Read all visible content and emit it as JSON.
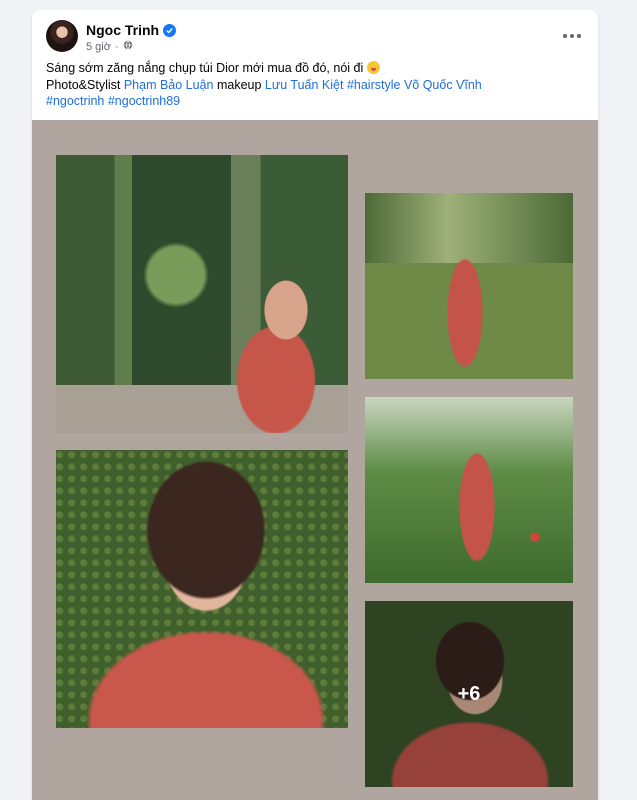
{
  "post": {
    "author": "Ngoc Trinh",
    "time": "5 giờ",
    "caption": {
      "line1": "Sáng sớm zăng nắng chụp túi Dior mới mua đồ đó, nói đi",
      "photo_prefix": "Photo&Stylist ",
      "photo_credit": "Phạm Bảo Luận",
      "makeup_prefix": "  makeup ",
      "makeup_credit": "Lưu Tuấn Kiệt",
      "hashtag_hairstyle": "#hairstyle",
      "hairstyle_credit": "Võ Quốc Vĩnh",
      "hashtag1": "#ngoctrinh",
      "hashtag2": "#ngoctrinh89"
    },
    "more_photos_label": "+6"
  },
  "icons": {
    "verified": "verified-badge-icon",
    "privacy": "globe-icon",
    "more": "more-options-icon",
    "emoji": "tongue-out-emoji"
  },
  "colors": {
    "link": "#216fdb",
    "verified": "#1877f2",
    "gallery_bg": "#b1a59f"
  }
}
